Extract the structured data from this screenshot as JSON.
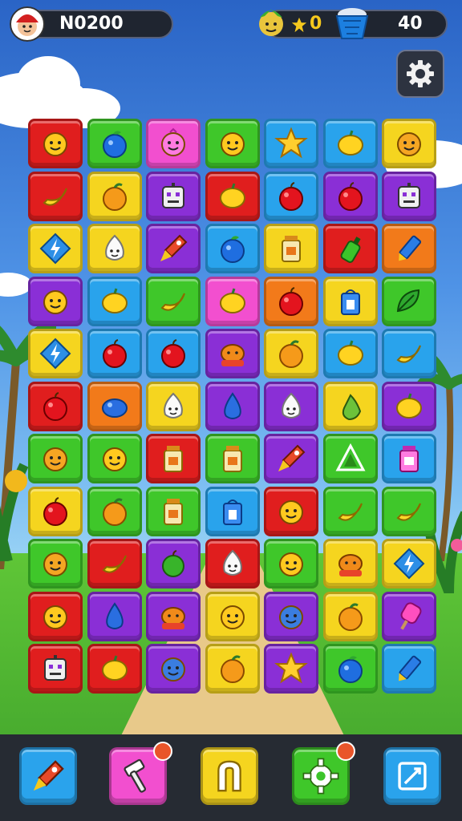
{
  "hud": {
    "player_code": "N0200",
    "stars_value": "0",
    "moves_value": "40"
  },
  "board": {
    "colors": {
      "red": "#e01e1e",
      "green": "#3fc72a",
      "pink": "#f24fcf",
      "blue": "#29a3ec",
      "yellow": "#f5d51f",
      "purple": "#8a2fd6",
      "orange": "#f27a1a"
    },
    "rows": [
      [
        [
          "red",
          "smiley"
        ],
        [
          "green",
          "blueberry"
        ],
        [
          "pink",
          "pink-blob"
        ],
        [
          "green",
          "smiley"
        ],
        [
          "blue",
          "star"
        ],
        [
          "blue",
          "lemon"
        ],
        [
          "yellow",
          "orange-smiley"
        ]
      ],
      [
        [
          "red",
          "banana"
        ],
        [
          "yellow",
          "orange-fruit"
        ],
        [
          "purple",
          "robot"
        ],
        [
          "red",
          "lemon"
        ],
        [
          "blue",
          "red-apple"
        ],
        [
          "purple",
          "red-apple"
        ],
        [
          "purple",
          "robot"
        ]
      ],
      [
        [
          "yellow",
          "lightning-gem"
        ],
        [
          "yellow",
          "garlic"
        ],
        [
          "purple",
          "rocket"
        ],
        [
          "blue",
          "blueberry"
        ],
        [
          "yellow",
          "jar"
        ],
        [
          "red",
          "bottle"
        ],
        [
          "orange",
          "crayon"
        ]
      ],
      [
        [
          "purple",
          "smiley"
        ],
        [
          "blue",
          "lemon"
        ],
        [
          "green",
          "banana"
        ],
        [
          "pink",
          "lemon"
        ],
        [
          "orange",
          "red-apple"
        ],
        [
          "yellow",
          "bag"
        ],
        [
          "green",
          "leaf"
        ]
      ],
      [
        [
          "yellow",
          "lightning-gem"
        ],
        [
          "blue",
          "red-apple"
        ],
        [
          "blue",
          "red-apple"
        ],
        [
          "purple",
          "pumpkin"
        ],
        [
          "yellow",
          "orange-fruit"
        ],
        [
          "blue",
          "lemon"
        ],
        [
          "blue",
          "banana"
        ]
      ],
      [
        [
          "red",
          "red-apple"
        ],
        [
          "orange",
          "blue-blob"
        ],
        [
          "yellow",
          "garlic"
        ],
        [
          "purple",
          "blue-drop"
        ],
        [
          "purple",
          "garlic"
        ],
        [
          "yellow",
          "pear"
        ],
        [
          "purple",
          "lemon"
        ]
      ],
      [
        [
          "green",
          "orange-smiley"
        ],
        [
          "green",
          "smiley"
        ],
        [
          "red",
          "jar"
        ],
        [
          "green",
          "jar"
        ],
        [
          "purple",
          "rocket"
        ],
        [
          "green",
          "triangle"
        ],
        [
          "blue",
          "pink-jar"
        ]
      ],
      [
        [
          "yellow",
          "red-apple"
        ],
        [
          "green",
          "orange-fruit"
        ],
        [
          "green",
          "jar"
        ],
        [
          "blue",
          "bag"
        ],
        [
          "red",
          "smiley"
        ],
        [
          "green",
          "banana"
        ],
        [
          "green",
          "banana"
        ]
      ],
      [
        [
          "green",
          "orange-smiley"
        ],
        [
          "red",
          "banana"
        ],
        [
          "purple",
          "green-apple"
        ],
        [
          "red",
          "garlic"
        ],
        [
          "green",
          "smiley"
        ],
        [
          "yellow",
          "pumpkin"
        ],
        [
          "yellow",
          "lightning-gem"
        ]
      ],
      [
        [
          "red",
          "smiley"
        ],
        [
          "purple",
          "blue-drop"
        ],
        [
          "purple",
          "pumpkin"
        ],
        [
          "yellow",
          "smiley"
        ],
        [
          "purple",
          "blue-smiley"
        ],
        [
          "yellow",
          "orange-fruit"
        ],
        [
          "purple",
          "popsicle"
        ]
      ],
      [
        [
          "red",
          "robot"
        ],
        [
          "red",
          "lemon"
        ],
        [
          "purple",
          "blue-smiley"
        ],
        [
          "yellow",
          "orange-fruit"
        ],
        [
          "purple",
          "star"
        ],
        [
          "green",
          "blueberry"
        ],
        [
          "blue",
          "crayon"
        ]
      ]
    ]
  },
  "toolbar": {
    "tools": [
      {
        "color": "blue",
        "icon": "rocket-icon",
        "badge": false
      },
      {
        "color": "pink",
        "icon": "hammer-icon",
        "badge": true
      },
      {
        "color": "yellow",
        "icon": "magnet-icon",
        "badge": false
      },
      {
        "color": "green",
        "icon": "gear-icon",
        "badge": true
      },
      {
        "color": "blue",
        "icon": "shuffle-square-icon",
        "badge": false
      }
    ]
  }
}
